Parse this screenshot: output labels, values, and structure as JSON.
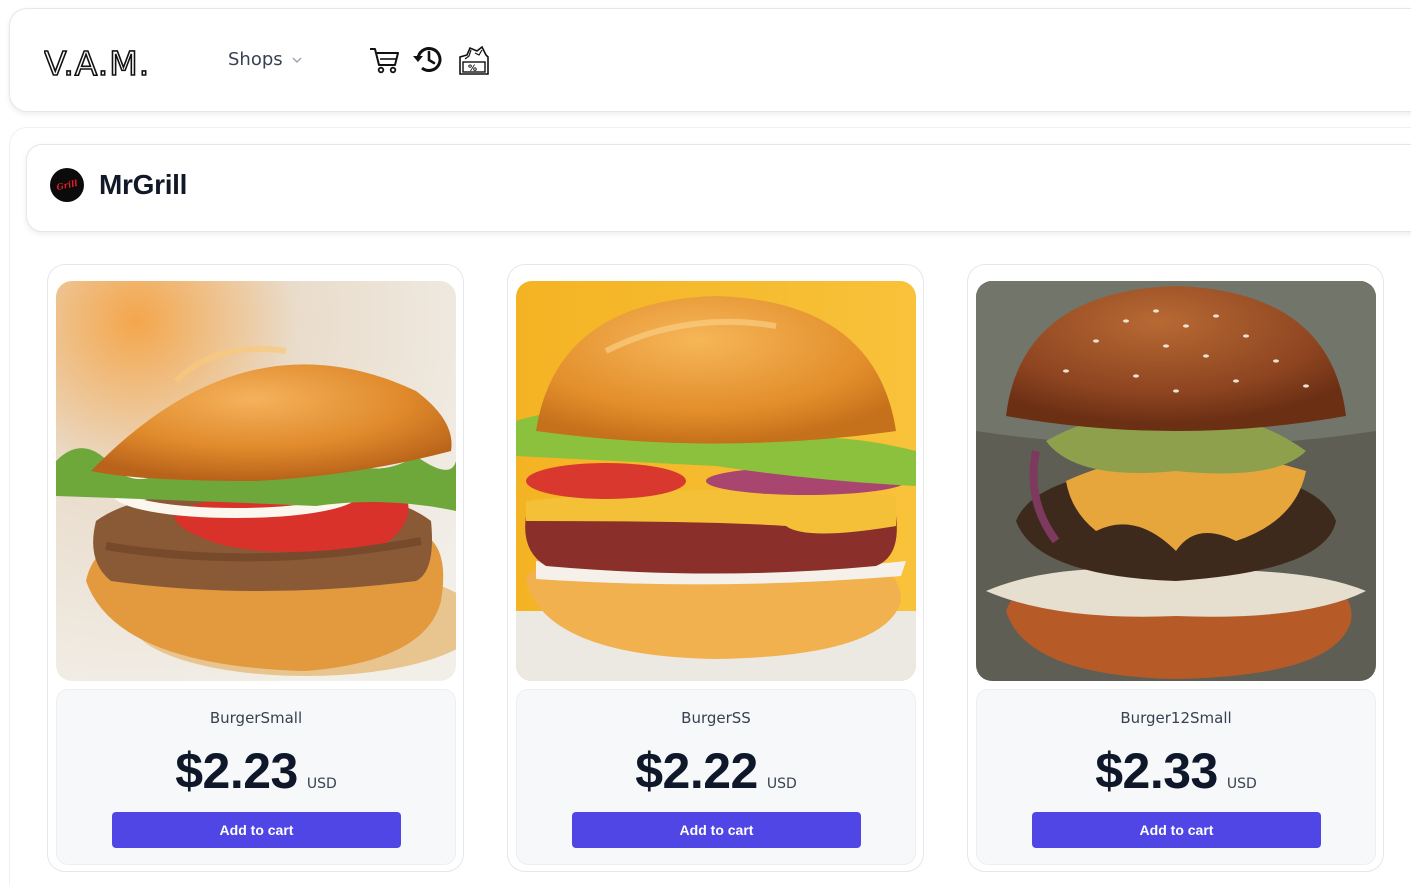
{
  "nav": {
    "logo_text": "V.A.M.",
    "shops_label": "Shops",
    "icons": [
      "cart-icon",
      "history-icon",
      "discount-coupon-icon"
    ]
  },
  "shop": {
    "name": "MrGrill",
    "avatar_text": "Grill"
  },
  "products": [
    {
      "name": "BurgerSmall",
      "price": "$2.23",
      "currency": "USD",
      "button": "Add to cart"
    },
    {
      "name": "BurgerSS",
      "price": "$2.22",
      "currency": "USD",
      "button": "Add to cart"
    },
    {
      "name": "Burger12Small",
      "price": "$2.33",
      "currency": "USD",
      "button": "Add to cart"
    }
  ],
  "colors": {
    "accent": "#4f46e5",
    "text_dark": "#0f172a",
    "card_info_bg": "#f7f8fa"
  }
}
